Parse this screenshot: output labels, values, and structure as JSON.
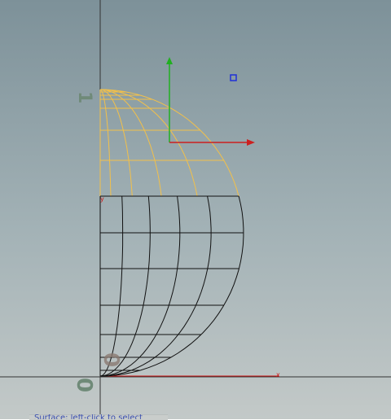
{
  "viewport": {
    "axis_numbers": {
      "one": "1",
      "zero_upper": "0",
      "zero_lower": "0"
    },
    "axis_letters": {
      "x": "x",
      "y": "y"
    },
    "colors": {
      "background_top": "#7d9199",
      "background_bottom": "#c3c9c8",
      "selected_wire": "#f2c04a",
      "unselected_wire": "#111111",
      "gizmo_y": "#20b020",
      "gizmo_x": "#cc2020",
      "axis_line": "#333333",
      "axis_x_red": "#d01818",
      "control_point": "#2030d8",
      "axis_number_color": "#6f8a78"
    },
    "gizmo": {
      "arrows": [
        "y-arrow",
        "x-arrow"
      ],
      "handle": "control-point-handle"
    },
    "status": {
      "text": "Surface: left-click to select"
    }
  }
}
